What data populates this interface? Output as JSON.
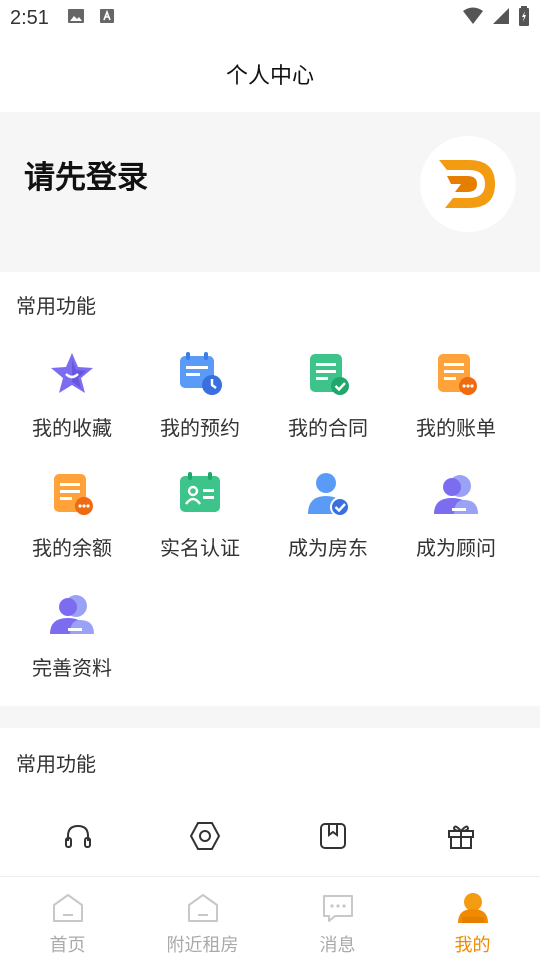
{
  "status_bar": {
    "time": "2:51"
  },
  "header": {
    "title": "个人中心"
  },
  "profile": {
    "login_prompt": "请先登录"
  },
  "common": {
    "title": "常用功能",
    "items": [
      {
        "label": "我的收藏",
        "icon": "star-icon"
      },
      {
        "label": "我的预约",
        "icon": "calendar-clock-icon"
      },
      {
        "label": "我的合同",
        "icon": "contract-check-icon"
      },
      {
        "label": "我的账单",
        "icon": "bill-icon"
      },
      {
        "label": "我的余额",
        "icon": "balance-icon"
      },
      {
        "label": "实名认证",
        "icon": "id-card-icon"
      },
      {
        "label": "成为房东",
        "icon": "landlord-icon"
      },
      {
        "label": "成为顾问",
        "icon": "consultant-icon"
      },
      {
        "label": "完善资料",
        "icon": "profile-edit-icon"
      }
    ]
  },
  "other": {
    "title": "常用功能",
    "items": [
      {
        "icon": "headset-icon"
      },
      {
        "icon": "settings-hexagon-icon"
      },
      {
        "icon": "bookmark-icon"
      },
      {
        "icon": "gift-icon"
      }
    ]
  },
  "tabbar": {
    "tabs": [
      {
        "label": "首页",
        "icon": "home-icon"
      },
      {
        "label": "附近租房",
        "icon": "nearby-home-icon"
      },
      {
        "label": "消息",
        "icon": "message-icon"
      },
      {
        "label": "我的",
        "icon": "user-icon",
        "active": true
      }
    ]
  },
  "colors": {
    "accent": "#f08a00",
    "section_bg": "#f6f6f6"
  }
}
